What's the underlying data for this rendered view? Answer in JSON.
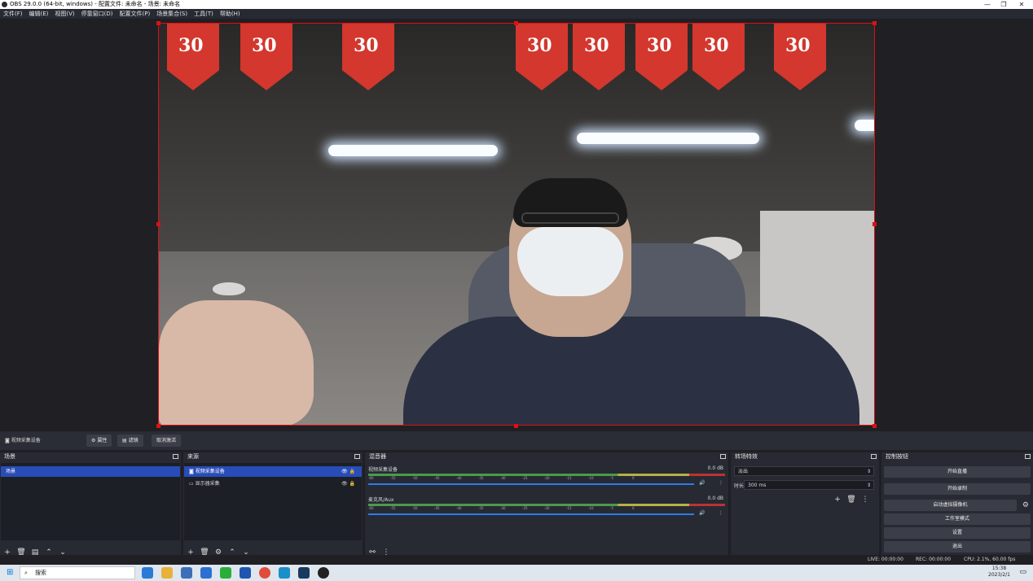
{
  "window": {
    "title": "OBS 29.0.0 (64-bit, windows) - 配置文件: 未命名 - 场景: 未命名"
  },
  "menu": [
    "文件(F)",
    "编辑(E)",
    "视图(V)",
    "停靠窗口(D)",
    "配置文件(P)",
    "场景集合(S)",
    "工具(T)",
    "帮助(H)"
  ],
  "preview": {
    "banner_text": "30"
  },
  "source_bar": {
    "selected_source": "视频采集设备",
    "properties": "属性",
    "filters": "滤镜",
    "deactivate": "取消激活"
  },
  "scenes": {
    "title": "场景",
    "items": [
      "场景"
    ]
  },
  "sources": {
    "title": "来源",
    "items": [
      "视频采集设备",
      "显示器采集"
    ]
  },
  "mixer": {
    "title": "混音器",
    "tracks": [
      {
        "name": "视频采集设备",
        "db": "0.0 dB"
      },
      {
        "name": "麦克风/Aux",
        "db": "0.0 dB"
      }
    ],
    "ticks": [
      "-60",
      "-55",
      "-50",
      "-45",
      "-40",
      "-35",
      "-30",
      "-25",
      "-20",
      "-15",
      "-10",
      "-5",
      "0"
    ]
  },
  "transitions": {
    "title": "转场特效",
    "type": "淡出",
    "duration_label": "时长",
    "duration": "300 ms"
  },
  "controls": {
    "title": "控制按钮",
    "buttons": [
      "开始直播",
      "开始录制",
      "启动虚拟摄像机",
      "工作室模式",
      "设置",
      "退出"
    ]
  },
  "status": {
    "live": "LIVE: 00:00:00",
    "rec": "REC: 00:00:00",
    "cpu": "CPU: 2.1%, 60.00 fps"
  },
  "taskbar": {
    "search": "搜索",
    "time": "15:38",
    "date": "2023/2/1"
  }
}
